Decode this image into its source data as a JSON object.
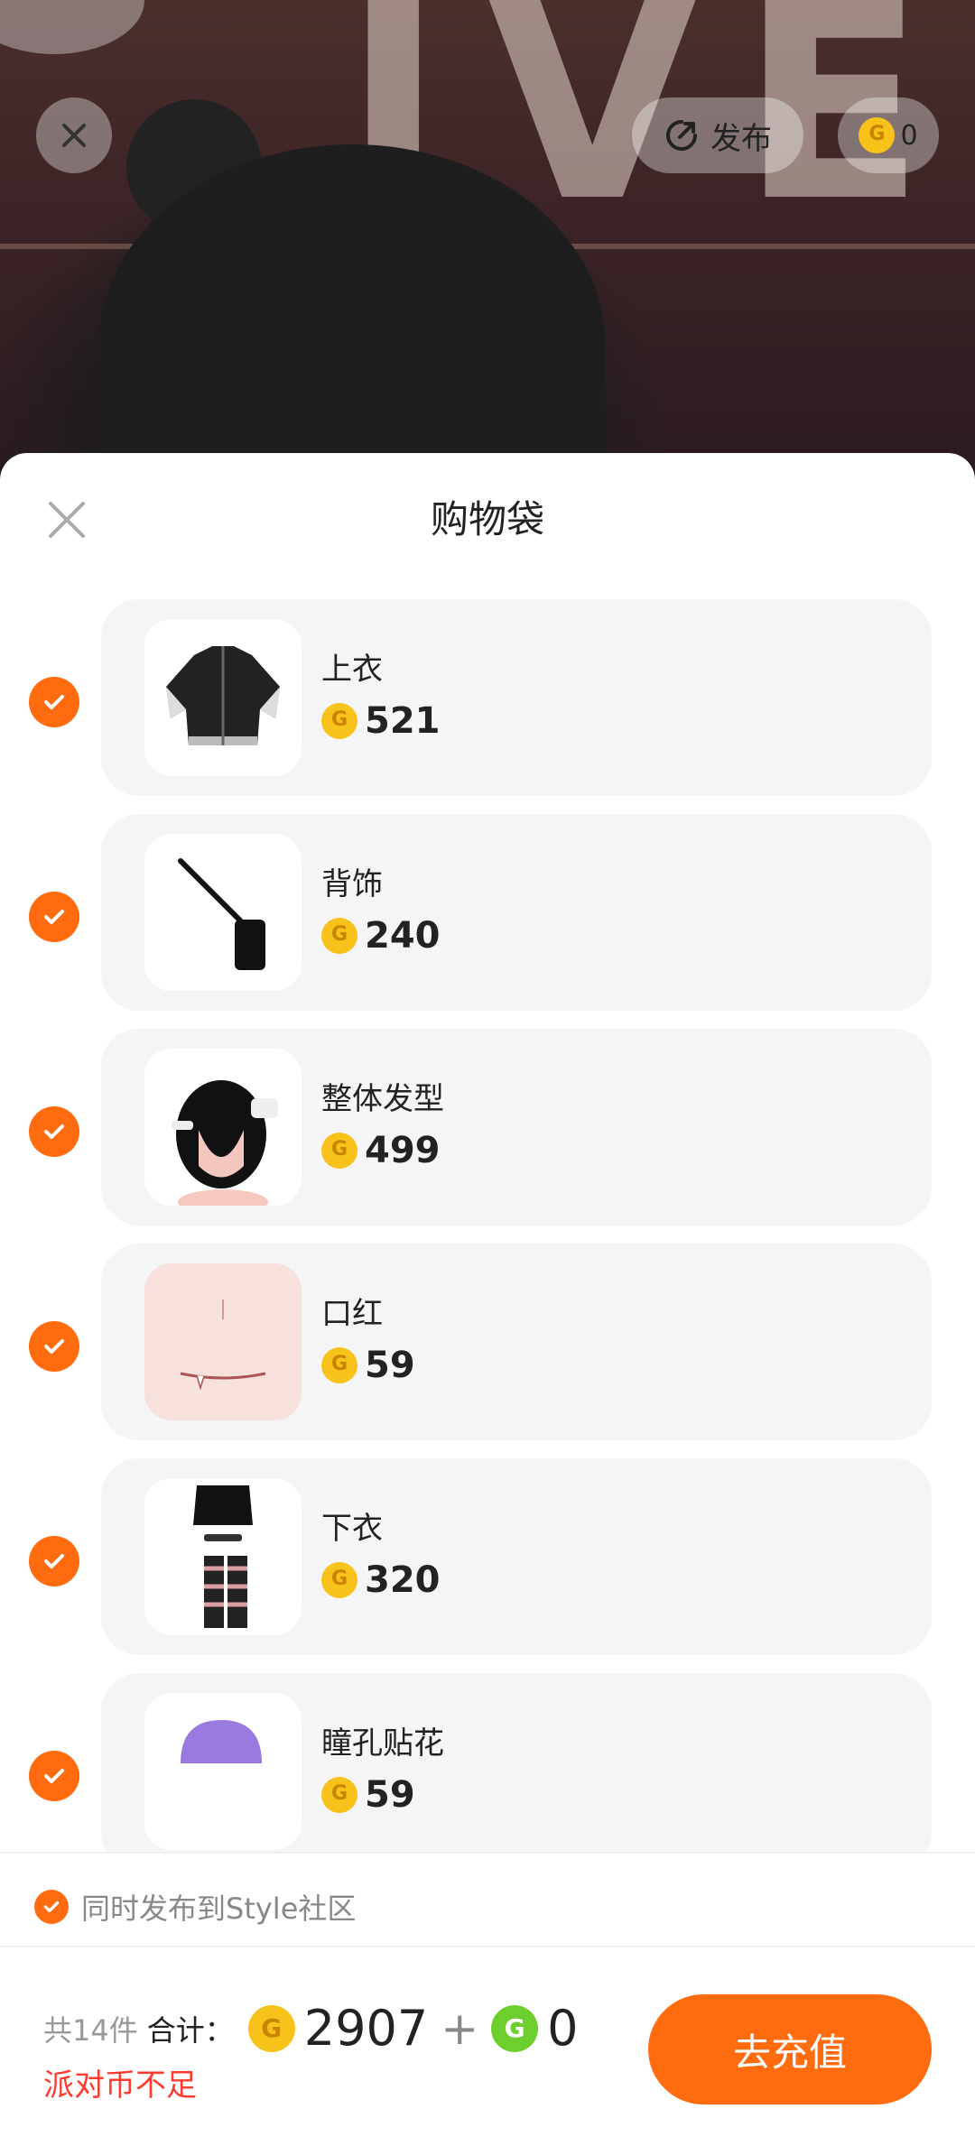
{
  "top_bar": {
    "publish_label": "发布",
    "coin_balance": "0"
  },
  "sheet": {
    "title": "购物袋",
    "items": [
      {
        "name": "上衣",
        "price": "521",
        "checked": true,
        "icon": "jacket-thumbnail"
      },
      {
        "name": "背饰",
        "price": "240",
        "checked": true,
        "icon": "bag-thumbnail"
      },
      {
        "name": "整体发型",
        "price": "499",
        "checked": true,
        "icon": "hair-thumbnail"
      },
      {
        "name": "口红",
        "price": "59",
        "checked": true,
        "icon": "lips-thumbnail"
      },
      {
        "name": "下衣",
        "price": "320",
        "checked": true,
        "icon": "skirt-thumbnail"
      },
      {
        "name": "瞳孔贴花",
        "price": "59",
        "checked": true,
        "icon": "pupil-decal-thumbnail"
      }
    ],
    "community_option": "同时发布到Style社区",
    "footer": {
      "count_label": "共14件",
      "total_label": "合计：",
      "gold_total": "2907",
      "plus": "+",
      "green_total": "0",
      "warning": "派对币不足",
      "recharge_label": "去充值"
    }
  },
  "colors": {
    "accent": "#ff6b0f",
    "warning": "#ff3b30",
    "gold_coin": "#f7c21a",
    "green_coin": "#6ccf2e",
    "card_bg": "#f5f5f8"
  }
}
